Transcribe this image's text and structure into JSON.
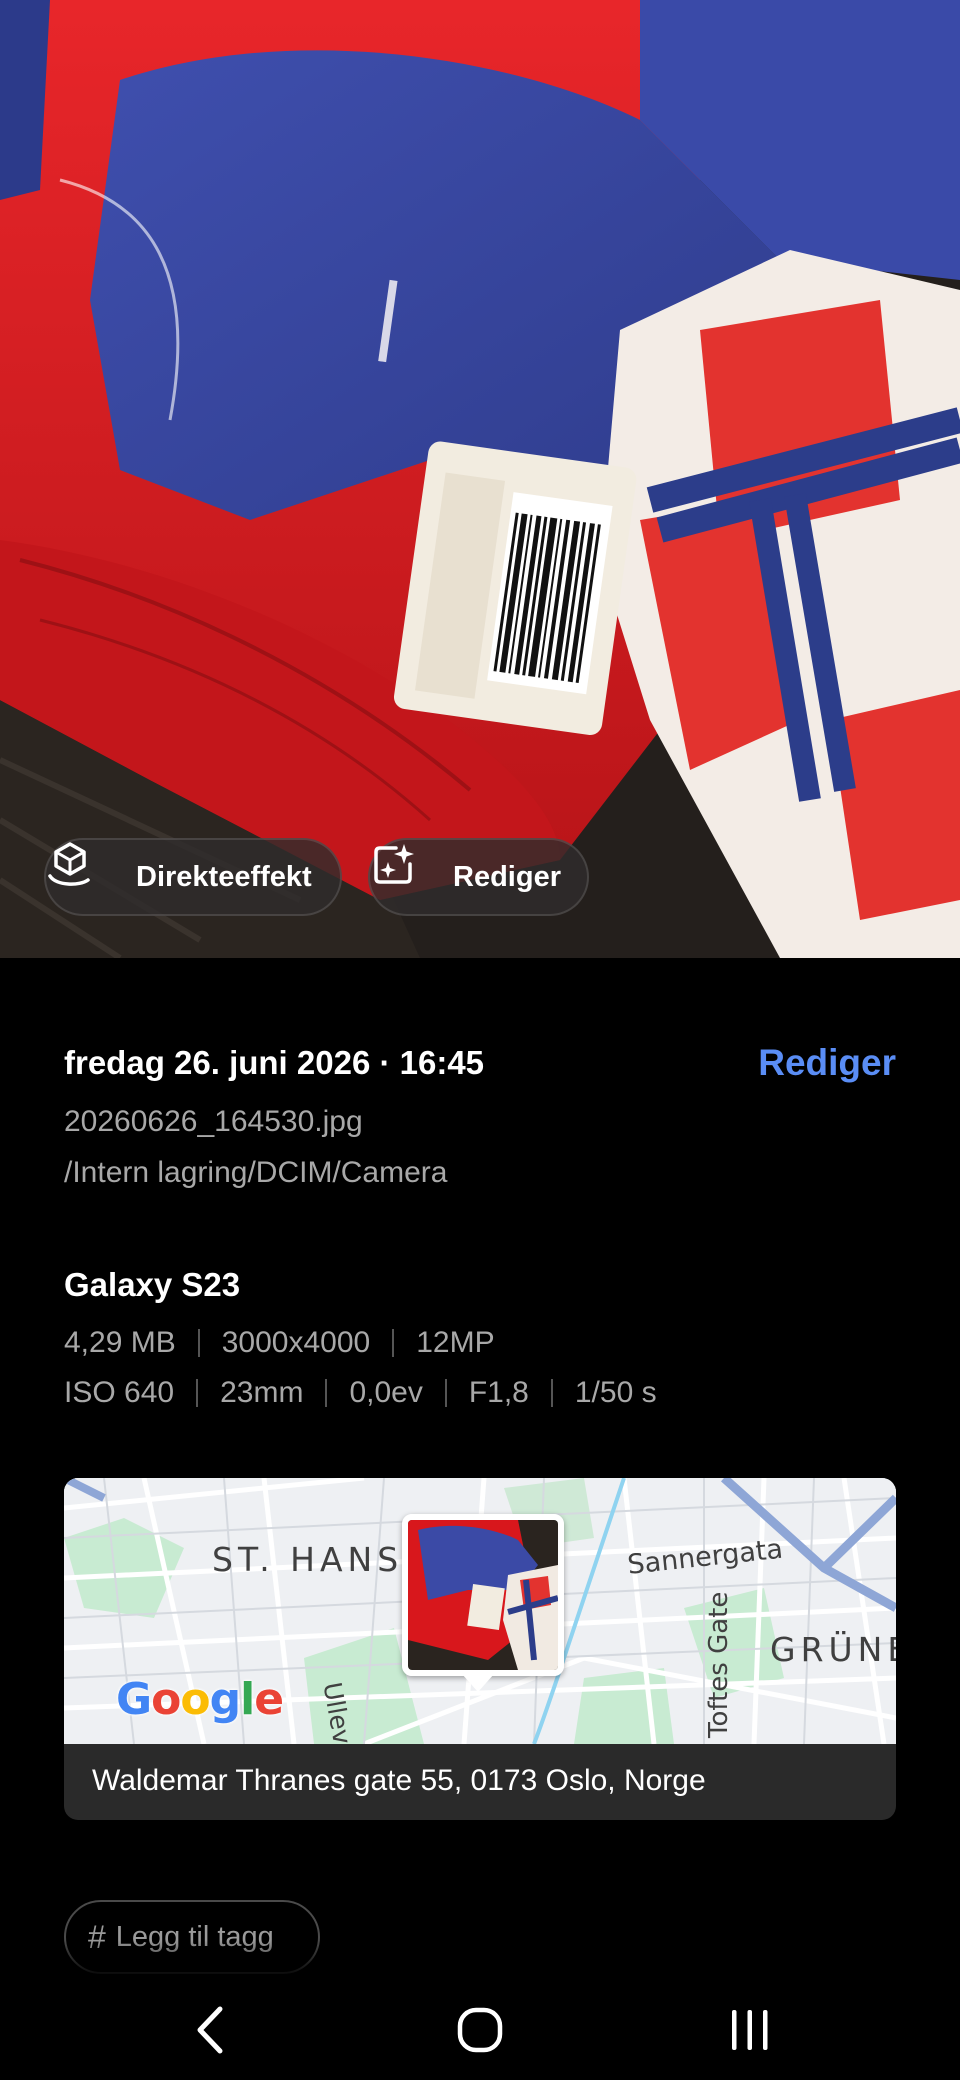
{
  "photo": {
    "actions": {
      "live_effect_label": "Direkteeffekt",
      "edit_label": "Rediger"
    }
  },
  "details": {
    "datetime": "fredag 26. juni 2026 · 16:45",
    "edit_link": "Rediger",
    "filename": "20260626_164530.jpg",
    "path": "/Intern lagring/DCIM/Camera",
    "device": "Galaxy S23",
    "file_info": {
      "size": "4,29 MB",
      "resolution": "3000x4000",
      "megapixels": "12MP"
    },
    "exif": {
      "iso": "ISO 640",
      "focal_length": "23mm",
      "exposure_value": "0,0ev",
      "aperture": "F1,8",
      "shutter": "1/50 s"
    }
  },
  "map": {
    "labels": {
      "district_1": "ST. HANS",
      "district_2": "GRÜNE",
      "street_1": "Sannergata",
      "street_2": "Toftes Gate",
      "street_3": "Ullevå"
    },
    "provider": {
      "G": "G",
      "o1": "o",
      "o2": "o",
      "g": "g",
      "l": "l",
      "e": "e"
    },
    "address": "Waldemar Thranes gate 55, 0173 Oslo, Norge"
  },
  "tags": {
    "add_tag_label": "Legg til tagg"
  },
  "colors": {
    "accent": "#5a8df5",
    "background": "#000000",
    "secondary_text": "#a8a8a8"
  },
  "icons": {
    "live_effect": "cube-hand-icon",
    "edit": "sparkle-edit-icon",
    "tag": "hash-icon",
    "back": "back-chevron-icon",
    "home": "home-icon",
    "recents": "recent-apps-icon"
  }
}
